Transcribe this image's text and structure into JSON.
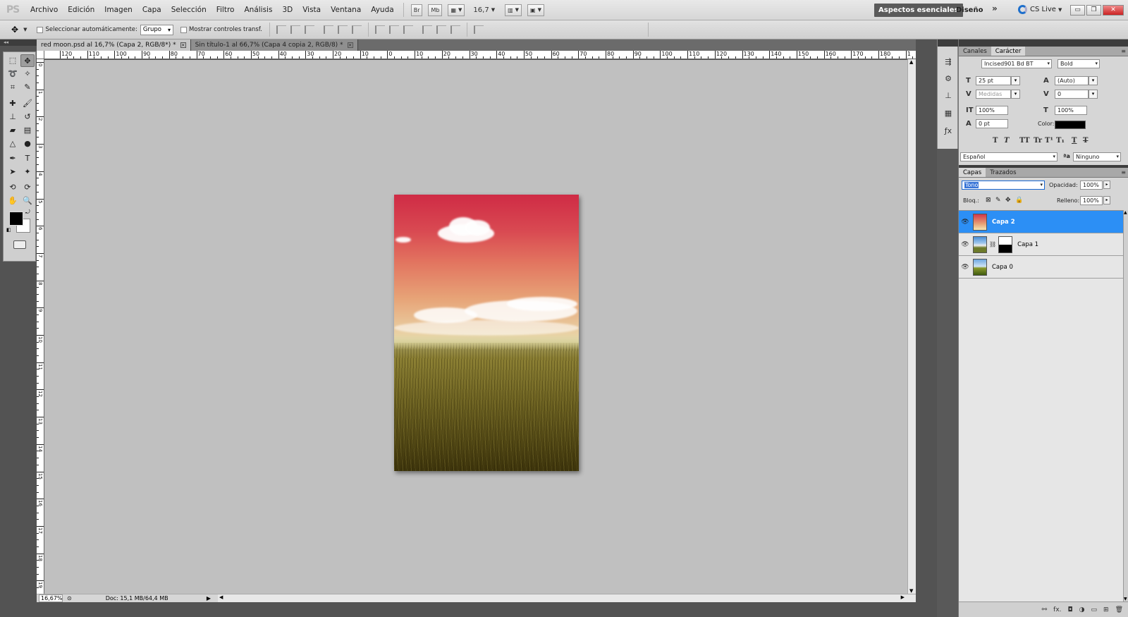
{
  "app": {
    "logo": "PS",
    "menus": [
      "Archivo",
      "Edición",
      "Imagen",
      "Capa",
      "Selección",
      "Filtro",
      "Análisis",
      "3D",
      "Vista",
      "Ventana",
      "Ayuda"
    ],
    "bridge_btn": "Br",
    "minibridge_btn": "Mb",
    "zoom": "16,7",
    "workspace_active": "Aspectos esenciales",
    "workspace_other": "Diseño",
    "more": "»",
    "cs_live": "CS Live"
  },
  "options_bar": {
    "auto_select_label": "Seleccionar automáticamente:",
    "auto_select_value": "Grupo",
    "transform_label": "Mostrar controles transf."
  },
  "tabs": [
    {
      "label": "red moon.psd al 16,7% (Capa 2, RGB/8*) *"
    },
    {
      "label": "Sin título-1 al 66,7% (Capa 4 copia 2, RGB/8) *"
    }
  ],
  "rulers": {
    "top": [
      "120",
      "110",
      "100",
      "90",
      "80",
      "70",
      "60",
      "50",
      "40",
      "30",
      "20",
      "10",
      "0",
      "10",
      "20",
      "30",
      "40",
      "50",
      "60",
      "70",
      "80",
      "90",
      "100",
      "110",
      "120",
      "130",
      "140",
      "150",
      "160",
      "170",
      "180",
      "1"
    ],
    "left": [
      "0",
      "1",
      "2",
      "3",
      "4",
      "5",
      "6",
      "7",
      "8",
      "9",
      "10",
      "11",
      "12",
      "13",
      "14",
      "15",
      "16",
      "17",
      "18",
      "19"
    ]
  },
  "status": {
    "zoom": "16,67%",
    "doc": "Doc: 15,1 MB/64,4 MB"
  },
  "character_panel": {
    "tabs": [
      "Canales",
      "Carácter"
    ],
    "font_family": "Incised901 Bd BT",
    "font_style": "Bold",
    "size": "25 pt",
    "leading": "(Auto)",
    "kerning": "Medidas",
    "tracking": "0",
    "vertical_scale": "100%",
    "horizontal_scale": "100%",
    "baseline_shift": "0 pt",
    "color_label": "Color:",
    "color_value": "#000000",
    "language": "Español",
    "antialias": "Ninguno",
    "typo_buttons": [
      "T",
      "T",
      "TT",
      "Tr",
      "T¹",
      "T₁",
      "T",
      "T"
    ]
  },
  "layers_panel": {
    "tabs": [
      "Capas",
      "Trazados"
    ],
    "blend_mode": "Tono",
    "opacity_label": "Opacidad:",
    "opacity": "100%",
    "lock_label": "Bloq.:",
    "fill_label": "Relleno:",
    "fill": "100%",
    "layers": [
      {
        "name": "Capa 2",
        "selected": true
      },
      {
        "name": "Capa 1",
        "selected": false,
        "has_mask": true
      },
      {
        "name": "Capa 0",
        "selected": false
      }
    ],
    "footer_icons": [
      "link-icon",
      "fx-icon",
      "mask-icon",
      "adjustment-icon",
      "group-icon",
      "new-layer-icon",
      "trash-icon"
    ],
    "footer_glyphs": [
      "⚯",
      "fx.",
      "◘",
      "◑",
      "▭",
      "⊞",
      "🗑"
    ]
  },
  "colors": {
    "accent_selected": "#2c8ff5",
    "foreground": "#000000",
    "background": "#ffffff"
  }
}
